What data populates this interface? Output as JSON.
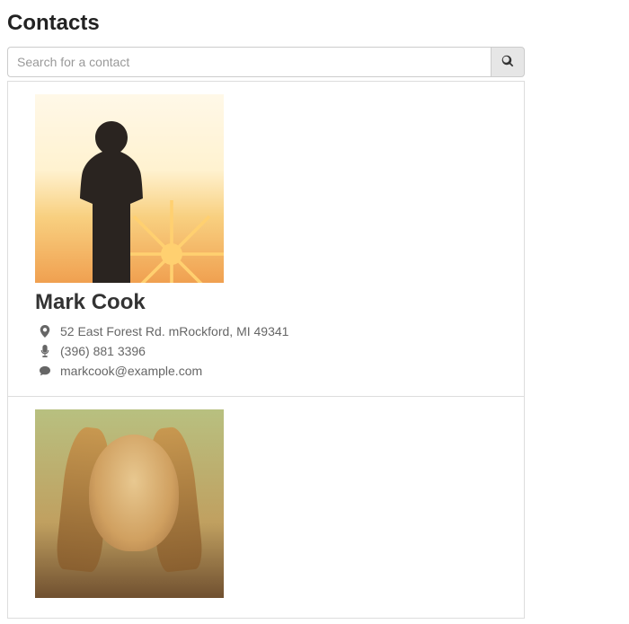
{
  "page_title": "Contacts",
  "search": {
    "placeholder": "Search for a contact",
    "value": ""
  },
  "contacts": [
    {
      "name": "Mark Cook",
      "address": "52 East Forest Rd. mRockford, MI 49341",
      "phone": "(396) 881 3396",
      "email": "markcook@example.com"
    },
    {
      "name": "",
      "address": "",
      "phone": "",
      "email": ""
    }
  ]
}
